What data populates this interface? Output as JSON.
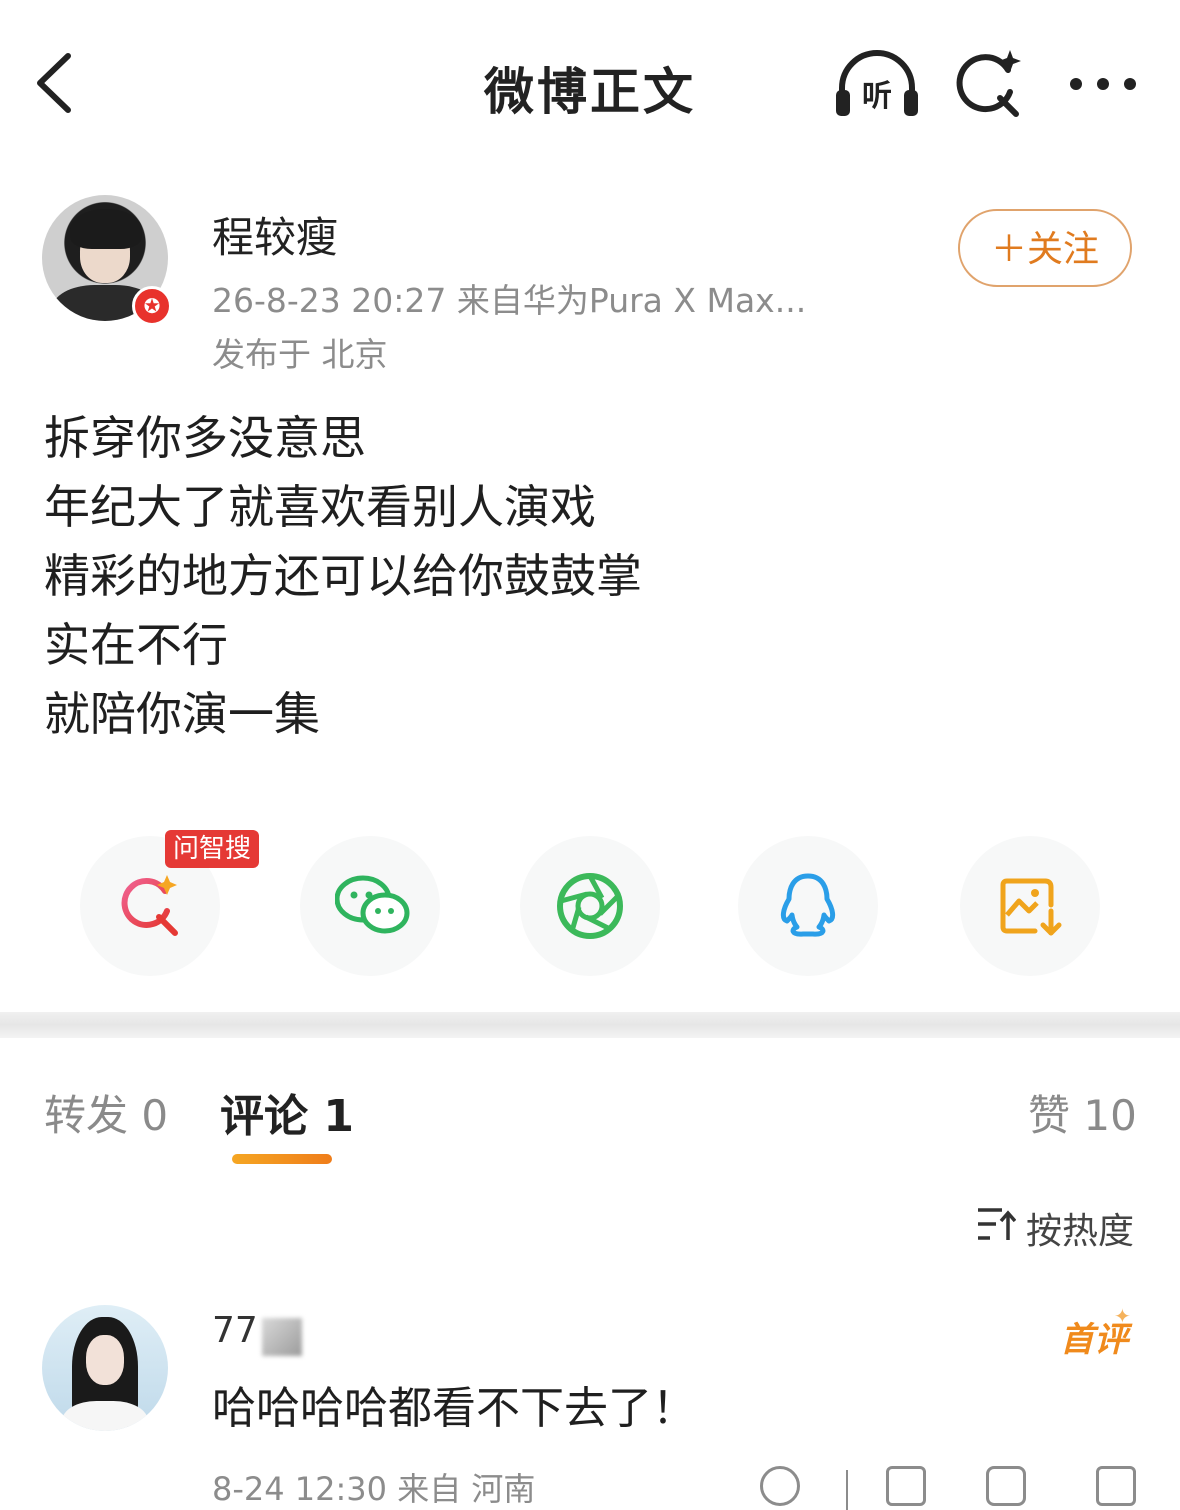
{
  "nav": {
    "title": "微博正文",
    "listen_label": "听",
    "icons": [
      "back-icon",
      "listen-icon",
      "ai-search-icon",
      "more-icon"
    ]
  },
  "post": {
    "author": "程较瘦",
    "meta": "26-8-23 20:27  来自华为Pura X Max...",
    "location": "发布于 北京",
    "follow_label": "＋关注",
    "lines": [
      "拆穿你多没意思",
      "年纪大了就喜欢看别人演戏",
      "精彩的地方还可以给你鼓鼓掌",
      "实在不行",
      "就陪你演一集"
    ]
  },
  "share": {
    "ai_tag": "问智搜",
    "items": [
      "ai-search",
      "wechat",
      "moments",
      "qq",
      "save-image"
    ]
  },
  "tabs": {
    "repost": "转发 0",
    "comment": "评论 1",
    "like": "赞 10"
  },
  "sort": {
    "label": "按热度"
  },
  "comment": {
    "user": "77",
    "first_badge": "首评",
    "text": "哈哈哈哈都看不下去了！",
    "meta": "8-24 12:30  来自 河南"
  },
  "colors": {
    "accent": "#ef7d1a",
    "ai_tag": "#e53935",
    "wechat": "#2fb45e",
    "moments": "#3cb95a",
    "qq": "#2a9ee8",
    "save": "#f0a41c"
  }
}
